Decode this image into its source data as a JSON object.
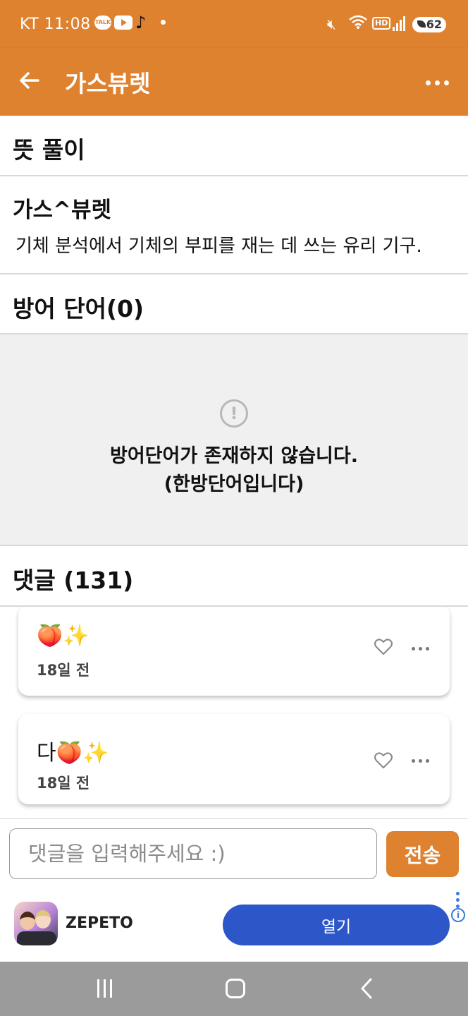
{
  "status_bar": {
    "carrier": "KT",
    "time": "11:08",
    "notif_talk_label": "TALK",
    "battery_level": "62"
  },
  "app_bar": {
    "title": "가스뷰렛"
  },
  "meaning_section": {
    "header": "뜻 풀이",
    "word": "가스^뷰렛",
    "definition": "기체 분석에서 기체의 부피를 재는 데 쓰는 유리 기구."
  },
  "defense_section": {
    "header": "방어 단어(0)",
    "empty_line1": "방어단어가 존재하지 않습니다.",
    "empty_line2": "(한방단어입니다)"
  },
  "comments_section": {
    "header": "댓글 (131)",
    "comments": [
      {
        "text": "🍑✨",
        "date": "18일 전"
      },
      {
        "text": "다🍑✨",
        "date": "18일 전"
      }
    ]
  },
  "comment_input": {
    "placeholder": "댓글을 입력해주세요 :)",
    "value": "",
    "send_label": "전송"
  },
  "ad": {
    "app_name": "ZEPETO",
    "open_label": "열기",
    "info_glyph": "i"
  },
  "colors": {
    "accent": "#df8230",
    "ad_button": "#2d57c9",
    "nav_bar": "#9b9b9b",
    "empty_bg": "#f0f0f0"
  }
}
